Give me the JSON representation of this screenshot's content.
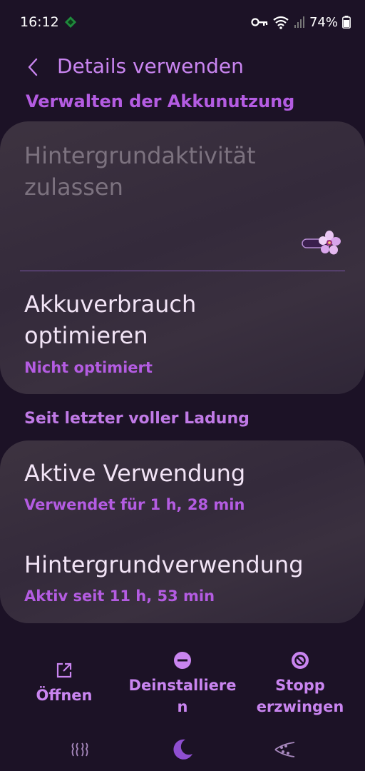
{
  "status_bar": {
    "time": "16:12",
    "battery": "74%",
    "icons": [
      "app-notification-icon",
      "vpn-key-icon",
      "wifi-icon",
      "signal-icon",
      "battery-icon"
    ]
  },
  "header": {
    "title": "Details verwenden",
    "back_icon": "chevron-left-icon"
  },
  "section_cut": "Verwalten der Akkunutzung",
  "card1": {
    "background_activity": {
      "title_line1": "Hintergrundaktivität",
      "title_line2": "zulassen",
      "toggle_state": "off",
      "toggle_icon": "flower-thumb-icon"
    },
    "optimize": {
      "title_line1": "Akkuverbrauch",
      "title_line2": "optimieren",
      "subtitle": "Nicht optimiert"
    }
  },
  "section_since_charge": "Seit letzter voller Ladung",
  "card2": {
    "active_use": {
      "title": "Aktive Verwendung",
      "subtitle": "Verwendet für 1 h, 28 min"
    },
    "background_use": {
      "title": "Hintergrundverwendung",
      "subtitle": "Aktiv seit 11 h, 53 min"
    }
  },
  "actions": {
    "open": {
      "label": "Öffnen",
      "icon": "open-external-icon"
    },
    "uninstall": {
      "label_line1": "Deinstalliere",
      "label_line2": "n",
      "icon": "minus-circle-icon"
    },
    "force_stop": {
      "label_line1": "Stopp",
      "label_line2": "erzwingen",
      "icon": "block-circle-icon"
    }
  },
  "navbar": {
    "icons": [
      "recents-icon",
      "home-moon-icon",
      "back-icon"
    ]
  },
  "colors": {
    "background": "#1c1226",
    "accent": "#c985f0",
    "accent_strong": "#b45ce2",
    "card": "#3a303f"
  }
}
